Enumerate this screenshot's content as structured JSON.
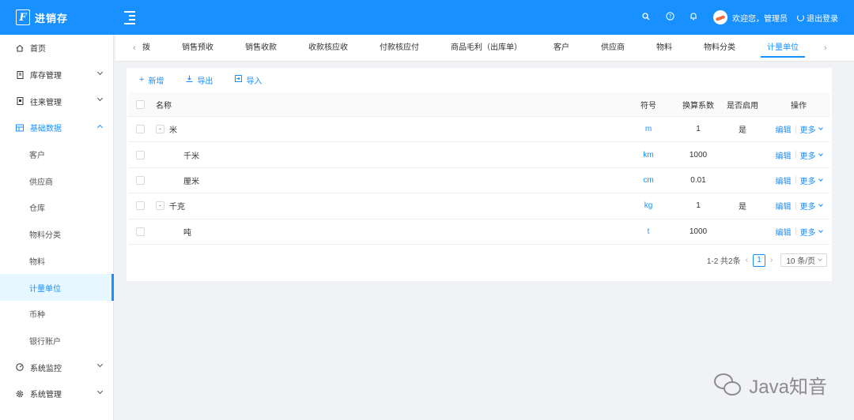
{
  "app": {
    "logo_mark": "F",
    "name": "进销存"
  },
  "header": {
    "icons": [
      "search-icon",
      "question-icon",
      "bell-icon"
    ],
    "user_label": "欢迎您，管理员",
    "logout_label": "退出登录"
  },
  "sidebar": {
    "items": [
      {
        "label": "首页",
        "icon": "home-icon"
      },
      {
        "label": "库存管理",
        "icon": "document-icon"
      },
      {
        "label": "往来管理",
        "icon": "ledger-icon"
      },
      {
        "label": "基础数据",
        "icon": "grid-icon"
      }
    ],
    "sub_items": [
      "客户",
      "供应商",
      "仓库",
      "物料分类",
      "物料",
      "计量单位",
      "币种",
      "银行账户"
    ],
    "bottom_items": [
      {
        "label": "系统监控",
        "icon": "gauge-icon"
      },
      {
        "label": "系统管理",
        "icon": "gear-icon"
      }
    ]
  },
  "tabs": {
    "items": [
      "拨",
      "销售预收",
      "销售收款",
      "收款核应收",
      "付款核应付",
      "商品毛利（出库单）",
      "客户",
      "供应商",
      "物料",
      "物料分类",
      "计量单位"
    ],
    "active": "计量单位"
  },
  "toolbar": {
    "add_label": "新增",
    "export_label": "导出",
    "import_label": "导入"
  },
  "table": {
    "headers": {
      "name": "名称",
      "symbol": "符号",
      "ratio": "换算系数",
      "enabled": "是否启用",
      "ops": "操作"
    },
    "rows": [
      {
        "name": "米",
        "symbol": "m",
        "ratio": "1",
        "enabled": "是",
        "level": 0,
        "expander": "-"
      },
      {
        "name": "千米",
        "symbol": "km",
        "ratio": "1000",
        "enabled": "",
        "level": 1,
        "expander": ""
      },
      {
        "name": "厘米",
        "symbol": "cm",
        "ratio": "0.01",
        "enabled": "",
        "level": 1,
        "expander": ""
      },
      {
        "name": "千克",
        "symbol": "kg",
        "ratio": "1",
        "enabled": "是",
        "level": 0,
        "expander": "-"
      },
      {
        "name": "吨",
        "symbol": "t",
        "ratio": "1000",
        "enabled": "",
        "level": 1,
        "expander": ""
      }
    ],
    "op_edit": "编辑",
    "op_more": "更多"
  },
  "pagination": {
    "summary": "1-2 共2条",
    "current_page": "1",
    "page_size": "10 条/页"
  },
  "watermark": {
    "text": "Java知音"
  },
  "colors": {
    "primary": "#1890ff",
    "active_bg": "#e6f7ff"
  }
}
